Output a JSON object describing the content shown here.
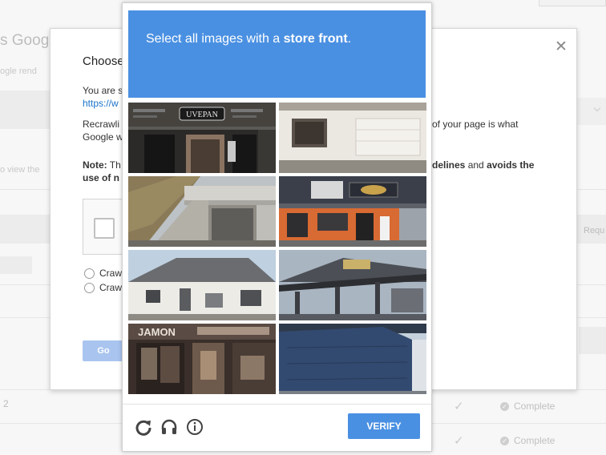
{
  "background": {
    "title": "s Goog",
    "subtitle": "ogle rend",
    "view_text": "o view the",
    "row_number": "2",
    "requ": "Requ",
    "status_rows": [
      {
        "label": "Complete"
      },
      {
        "label": "Complete"
      }
    ]
  },
  "dialog": {
    "title": "Choose",
    "line1": "You are s",
    "link": "https://w",
    "line2a": "Recrawli",
    "line2b": "Google w",
    "line2_right": "of your page is what",
    "note_label": "Note:",
    "note_text": " Th",
    "note_line2": "use of n",
    "note_right_1": "delines",
    "note_right_2": " and ",
    "note_right_3": "avoids the",
    "radio_1": "Craw",
    "radio_2": "Craw",
    "go_label": "Go"
  },
  "recaptcha": {
    "header_prefix": "Select all images with a ",
    "header_target": "store front",
    "header_suffix": ".",
    "verify_label": "VERIFY",
    "tiles": [
      {
        "sign": "UVEPAN"
      },
      {
        "sign": ""
      },
      {
        "sign": ""
      },
      {
        "sign": ""
      },
      {
        "sign": ""
      },
      {
        "sign": ""
      },
      {
        "sign": "JAMON"
      },
      {
        "sign": ""
      }
    ],
    "colors": {
      "accent": "#4a90e2"
    }
  }
}
